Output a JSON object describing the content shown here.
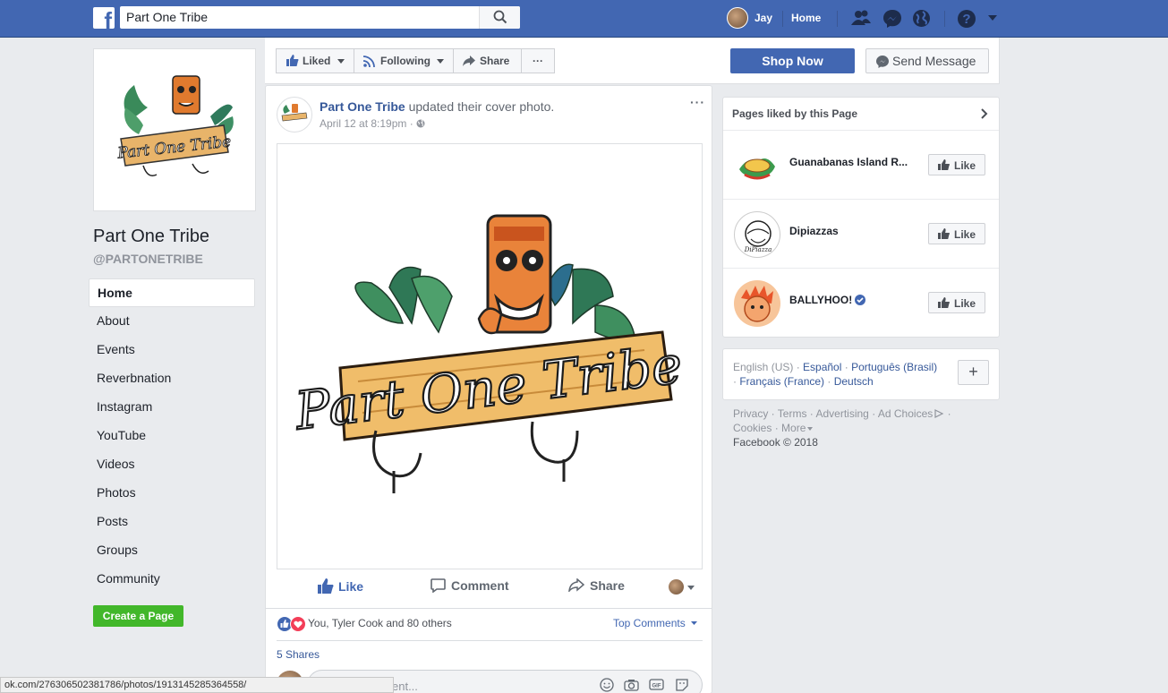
{
  "topbar": {
    "search_value": "Part One Tribe",
    "user_name": "Jay",
    "home_label": "Home"
  },
  "page": {
    "name": "Part One Tribe",
    "handle": "@PARTONETRIBE"
  },
  "leftnav": {
    "items": [
      "Home",
      "About",
      "Events",
      "Reverbnation",
      "Instagram",
      "YouTube",
      "Videos",
      "Photos",
      "Posts",
      "Groups",
      "Community"
    ],
    "create_page": "Create a Page"
  },
  "actionbar": {
    "liked": "Liked",
    "following": "Following",
    "share": "Share",
    "more": "···",
    "shop_now": "Shop Now",
    "send_message": "Send Message"
  },
  "post": {
    "author": "Part One Tribe",
    "action_text": " updated their cover photo.",
    "date": "April 12 at 8:19pm",
    "meta_sep": " · ",
    "more": "···",
    "like_label": "Like",
    "comment_label": "Comment",
    "share_label": "Share",
    "reactions_text": "You, Tyler Cook and 80 others",
    "top_comments": "Top Comments",
    "shares": "5 Shares",
    "comment_placeholder": "ent..."
  },
  "status_url": "ok.com/276306502381786/photos/1913145285364558/",
  "pages_liked": {
    "title": "Pages liked by this Page",
    "like_label": "Like",
    "items": [
      {
        "name": "Guanabanas Island R..."
      },
      {
        "name": "Dipiazzas"
      },
      {
        "name": "BALLYHOO!"
      }
    ]
  },
  "languages": {
    "current": "English (US)",
    "others": [
      "Español",
      "Português (Brasil)",
      "Français (France)",
      "Deutsch"
    ],
    "add": "+"
  },
  "footer": {
    "links": [
      "Privacy",
      "Terms",
      "Advertising",
      "Ad Choices",
      "Cookies",
      "More"
    ],
    "copyright": "Facebook © 2018"
  },
  "colors": {
    "brand": "#4267b2",
    "green": "#42b72a",
    "bg": "#e9ebee"
  }
}
